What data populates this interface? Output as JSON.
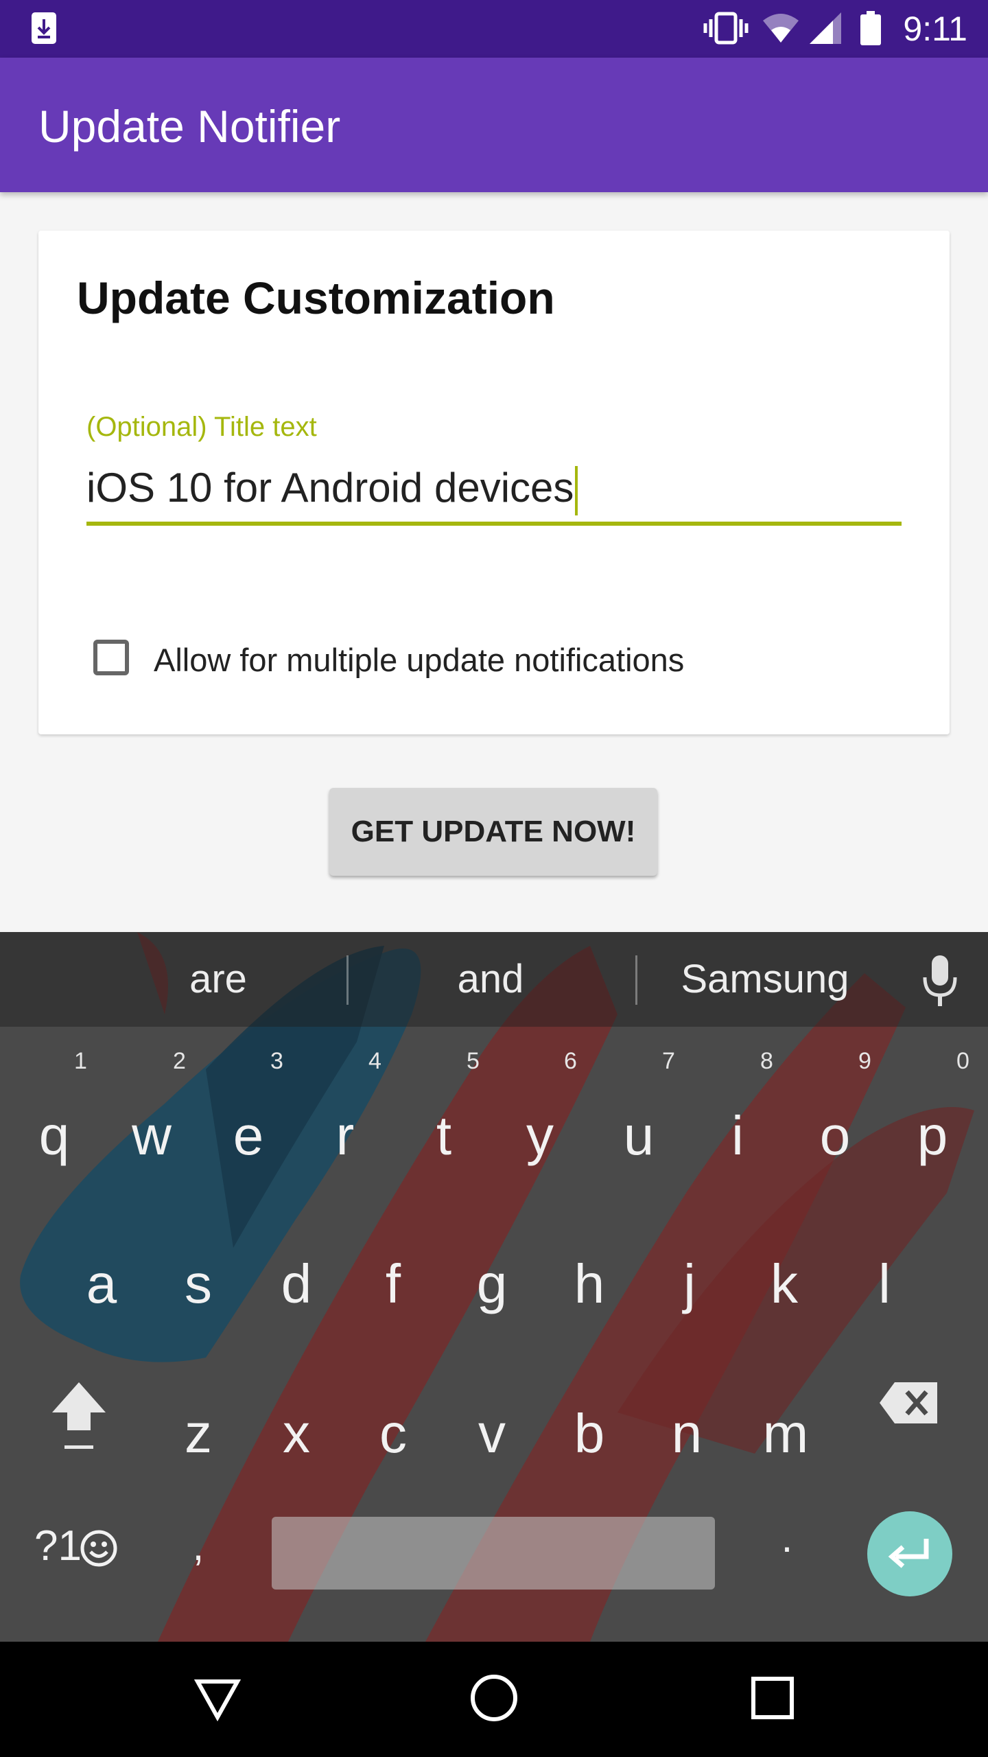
{
  "status_bar": {
    "time": "9:11"
  },
  "app_bar": {
    "title": "Update Notifier"
  },
  "card": {
    "title": "Update Customization",
    "field_label": "(Optional) Title text",
    "field_value": "iOS 10 for Android devices",
    "checkbox_label": "Allow for multiple update notifications",
    "checkbox_checked": false
  },
  "button": {
    "label": "GET UPDATE NOW!"
  },
  "keyboard": {
    "suggestions": [
      "are",
      "and",
      "Samsung"
    ],
    "row1": [
      "q",
      "w",
      "e",
      "r",
      "t",
      "y",
      "u",
      "i",
      "o",
      "p"
    ],
    "row1_hints": [
      "1",
      "2",
      "3",
      "4",
      "5",
      "6",
      "7",
      "8",
      "9",
      "0"
    ],
    "row2": [
      "a",
      "s",
      "d",
      "f",
      "g",
      "h",
      "j",
      "k",
      "l"
    ],
    "row3": [
      "z",
      "x",
      "c",
      "v",
      "b",
      "n",
      "m"
    ],
    "symbols_label": "?1",
    "comma": ",",
    "period": "."
  },
  "colors": {
    "status_bar": "#3f1a8a",
    "app_bar": "#673ab7",
    "accent": "#a5b70e",
    "enter_key": "#7ecec5"
  }
}
